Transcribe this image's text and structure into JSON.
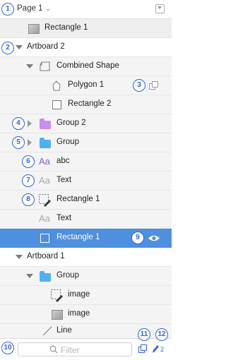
{
  "page": {
    "label": "Page 1",
    "badge": "1"
  },
  "layers": [
    {
      "label": "Rectangle 1"
    },
    {
      "label": "Artboard 2",
      "badge": "2"
    },
    {
      "label": "Combined Shape"
    },
    {
      "label": "Polygon 1",
      "badge": "3"
    },
    {
      "label": "Rectangle 2"
    },
    {
      "label": "Group 2",
      "badge": "4"
    },
    {
      "label": "Group",
      "badge": "5"
    },
    {
      "label": "abc",
      "badge": "6"
    },
    {
      "label": "Text",
      "badge": "7"
    },
    {
      "label": "Rectangle 1",
      "badge": "8"
    },
    {
      "label": "Text"
    },
    {
      "label": "Rectangle 1",
      "badge": "9"
    },
    {
      "label": "Artboard 1"
    },
    {
      "label": "Group"
    },
    {
      "label": "image"
    },
    {
      "label": "image"
    },
    {
      "label": "Line"
    }
  ],
  "text_glyph": "Aa",
  "filter": {
    "placeholder": "Filter",
    "badge": "10"
  },
  "bottom": {
    "badge_copy": "11",
    "badge_edit": "12",
    "edit_count": "2"
  },
  "colors": {
    "selection": "#4e8fde",
    "badge": "#2f62e0",
    "folder_purple": "#c88ef0",
    "folder_blue": "#4fb0f0",
    "text_glyph_purple": "#8a5bc8"
  }
}
